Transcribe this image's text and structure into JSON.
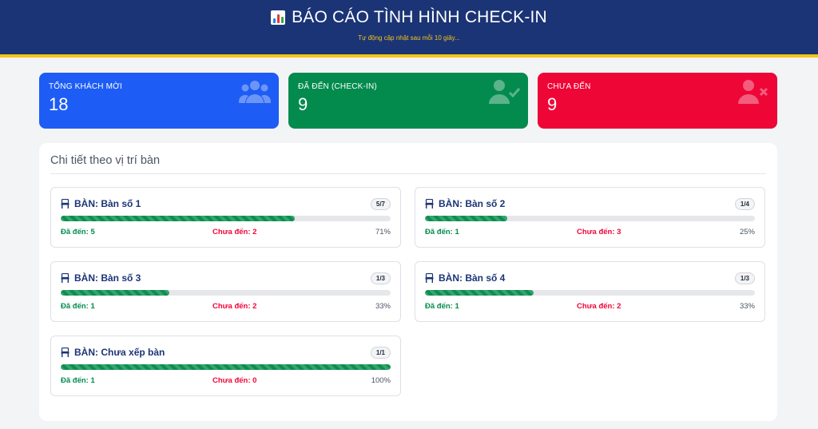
{
  "header": {
    "title": "BÁO CÁO TÌNH HÌNH CHECK-IN",
    "subtitle": "Tự động cập nhật sau mỗi 10 giây...",
    "icon": "bar-chart-icon"
  },
  "stats": [
    {
      "label": "TỔNG KHÁCH MỜI",
      "value": "18",
      "color": "#1d5cf5",
      "icon": "users-icon"
    },
    {
      "label": "ĐÃ ĐẾN (CHECK-IN)",
      "value": "9",
      "color": "#038b4e",
      "icon": "user-check-icon"
    },
    {
      "label": "CHƯA ĐẾN",
      "value": "9",
      "color": "#ee0637",
      "icon": "user-x-icon"
    }
  ],
  "panel": {
    "title": "Chi tiết theo vị trí bàn",
    "tables": [
      {
        "title": "BÀN: Bàn số 1",
        "badge": "5/7",
        "progress": 0.71,
        "arrived": "Đã đến: 5",
        "missing": "Chưa đến: 2",
        "percent": "71%"
      },
      {
        "title": "BÀN: Bàn số 2",
        "badge": "1/4",
        "progress": 0.25,
        "arrived": "Đã đến: 1",
        "missing": "Chưa đến: 3",
        "percent": "25%"
      },
      {
        "title": "BÀN: Bàn số 3",
        "badge": "1/3",
        "progress": 0.33,
        "arrived": "Đã đến: 1",
        "missing": "Chưa đến: 2",
        "percent": "33%"
      },
      {
        "title": "BÀN: Bàn số 4",
        "badge": "1/3",
        "progress": 0.33,
        "arrived": "Đã đến: 1",
        "missing": "Chưa đến: 2",
        "percent": "33%"
      },
      {
        "title": "BÀN: Chưa xếp bàn",
        "badge": "1/1",
        "progress": 1.0,
        "arrived": "Đã đến: 1",
        "missing": "Chưa đến: 0",
        "percent": "100%"
      }
    ]
  },
  "colors": {
    "header_bg": "#1b3476",
    "accent": "#f5c518",
    "progress": "#0b8f4f"
  }
}
